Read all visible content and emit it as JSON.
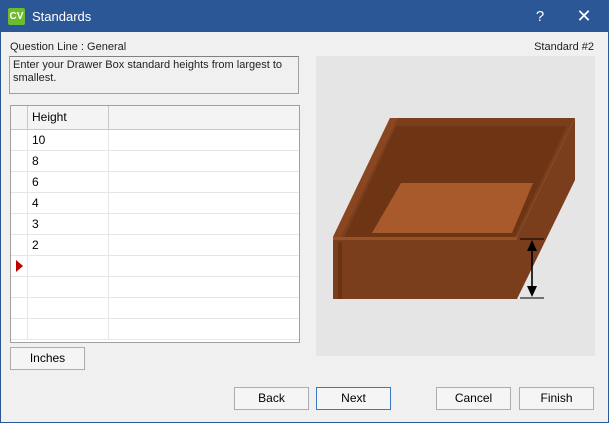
{
  "window": {
    "app_icon_text": "CV",
    "title": "Standards",
    "help_label": "?",
    "close_label": "✕"
  },
  "header": {
    "question_line": "Question Line : General",
    "standard_number": "Standard #2"
  },
  "instructions": "Enter your Drawer Box standard heights from largest to smallest.",
  "grid": {
    "column_header": "Height",
    "rows": [
      "10",
      "8",
      "6",
      "4",
      "3",
      "2",
      ""
    ],
    "current_row_index": 6,
    "indicator_color": "#c00000"
  },
  "buttons": {
    "inches": "Inches",
    "back": "Back",
    "next": "Next",
    "cancel": "Cancel",
    "finish": "Finish"
  },
  "colors": {
    "titlebar": "#2b5797",
    "wood_dark": "#7b3e1c",
    "wood_light": "#a95a2c",
    "preview_bg": "#e5e5e5"
  },
  "icons": {
    "app": "cv-logo-icon",
    "help": "help-icon",
    "close": "close-icon",
    "row_pointer": "current-row-arrow-icon",
    "dimension": "height-dimension-arrow-icon"
  }
}
